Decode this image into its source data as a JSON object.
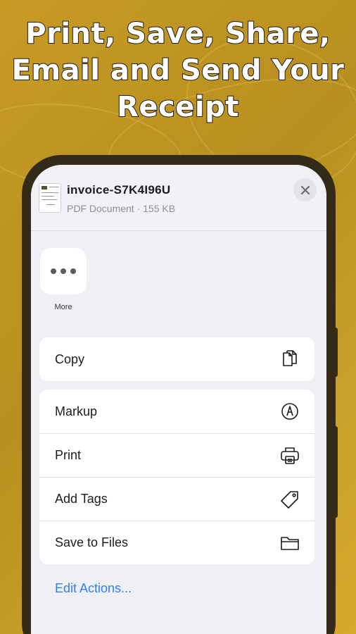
{
  "headline": {
    "line1": "Print, Save, Share,",
    "line2": "Email and Send Your",
    "line3": "Receipt"
  },
  "share_sheet": {
    "file_name": "invoice-S7K4I96U",
    "file_meta": "PDF Document · 155 KB",
    "close_icon": "close-icon",
    "apps": [
      {
        "label": "More",
        "icon": "more-dots-icon"
      }
    ],
    "actions_primary": [
      {
        "label": "Copy",
        "icon": "copy-icon"
      }
    ],
    "actions_secondary": [
      {
        "label": "Markup",
        "icon": "markup-icon"
      },
      {
        "label": "Print",
        "icon": "printer-icon"
      },
      {
        "label": "Add Tags",
        "icon": "tag-icon"
      },
      {
        "label": "Save to Files",
        "icon": "folder-icon"
      }
    ],
    "edit_actions_label": "Edit Actions..."
  },
  "colors": {
    "background": "#c49a25",
    "link": "#2f7ff0",
    "phone_frame": "#332a18"
  }
}
